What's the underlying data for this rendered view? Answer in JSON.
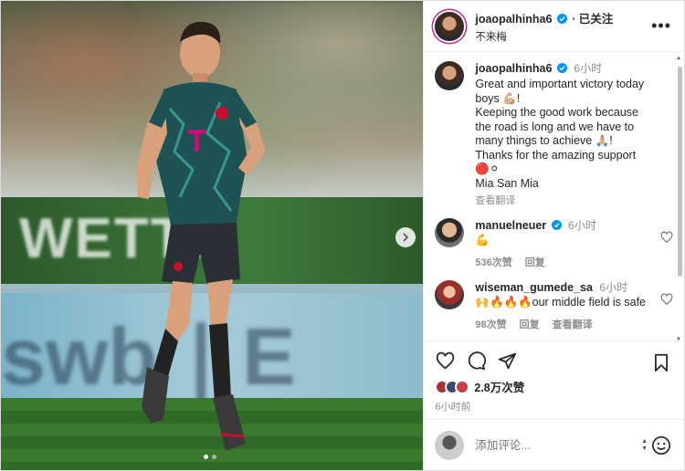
{
  "post": {
    "author": "joaopalhinha6",
    "follow_status": "· 已关注",
    "subtitle": "不来梅",
    "more_label": "•••",
    "media": {
      "banner_text": "WETTE",
      "board_text": "swb ∣ E",
      "carousel_dots": 2,
      "active_dot": 1
    },
    "caption": {
      "username": "joaopalhinha6",
      "time": "6小时",
      "lines": [
        "Great and important victory today boys 💪🏼!",
        "Keeping the good work because the road is long and we have to many things to achieve 🙏🏼!",
        "Thanks for the amazing support 🔴⚪",
        "Mia San Mia"
      ],
      "translate": "查看翻译"
    },
    "comments": [
      {
        "username": "manuelneuer",
        "time": "6小时",
        "text": "💪",
        "likes": "536次赞",
        "reply": "回复",
        "translate": ""
      },
      {
        "username": "wiseman_gumede_sa",
        "time": "6小时",
        "text": "🙌🔥🔥🔥our middle field is safe",
        "likes": "98次赞",
        "reply": "回复",
        "translate": "查看翻译"
      }
    ],
    "likes_count": "2.8万次赞",
    "posted_ago": "6小时前",
    "comment_placeholder": "添加评论..."
  },
  "colors": {
    "verified": "#0095f6",
    "text": "#262626",
    "muted": "#8e8e8e",
    "story_ring": "#c42c8a"
  }
}
